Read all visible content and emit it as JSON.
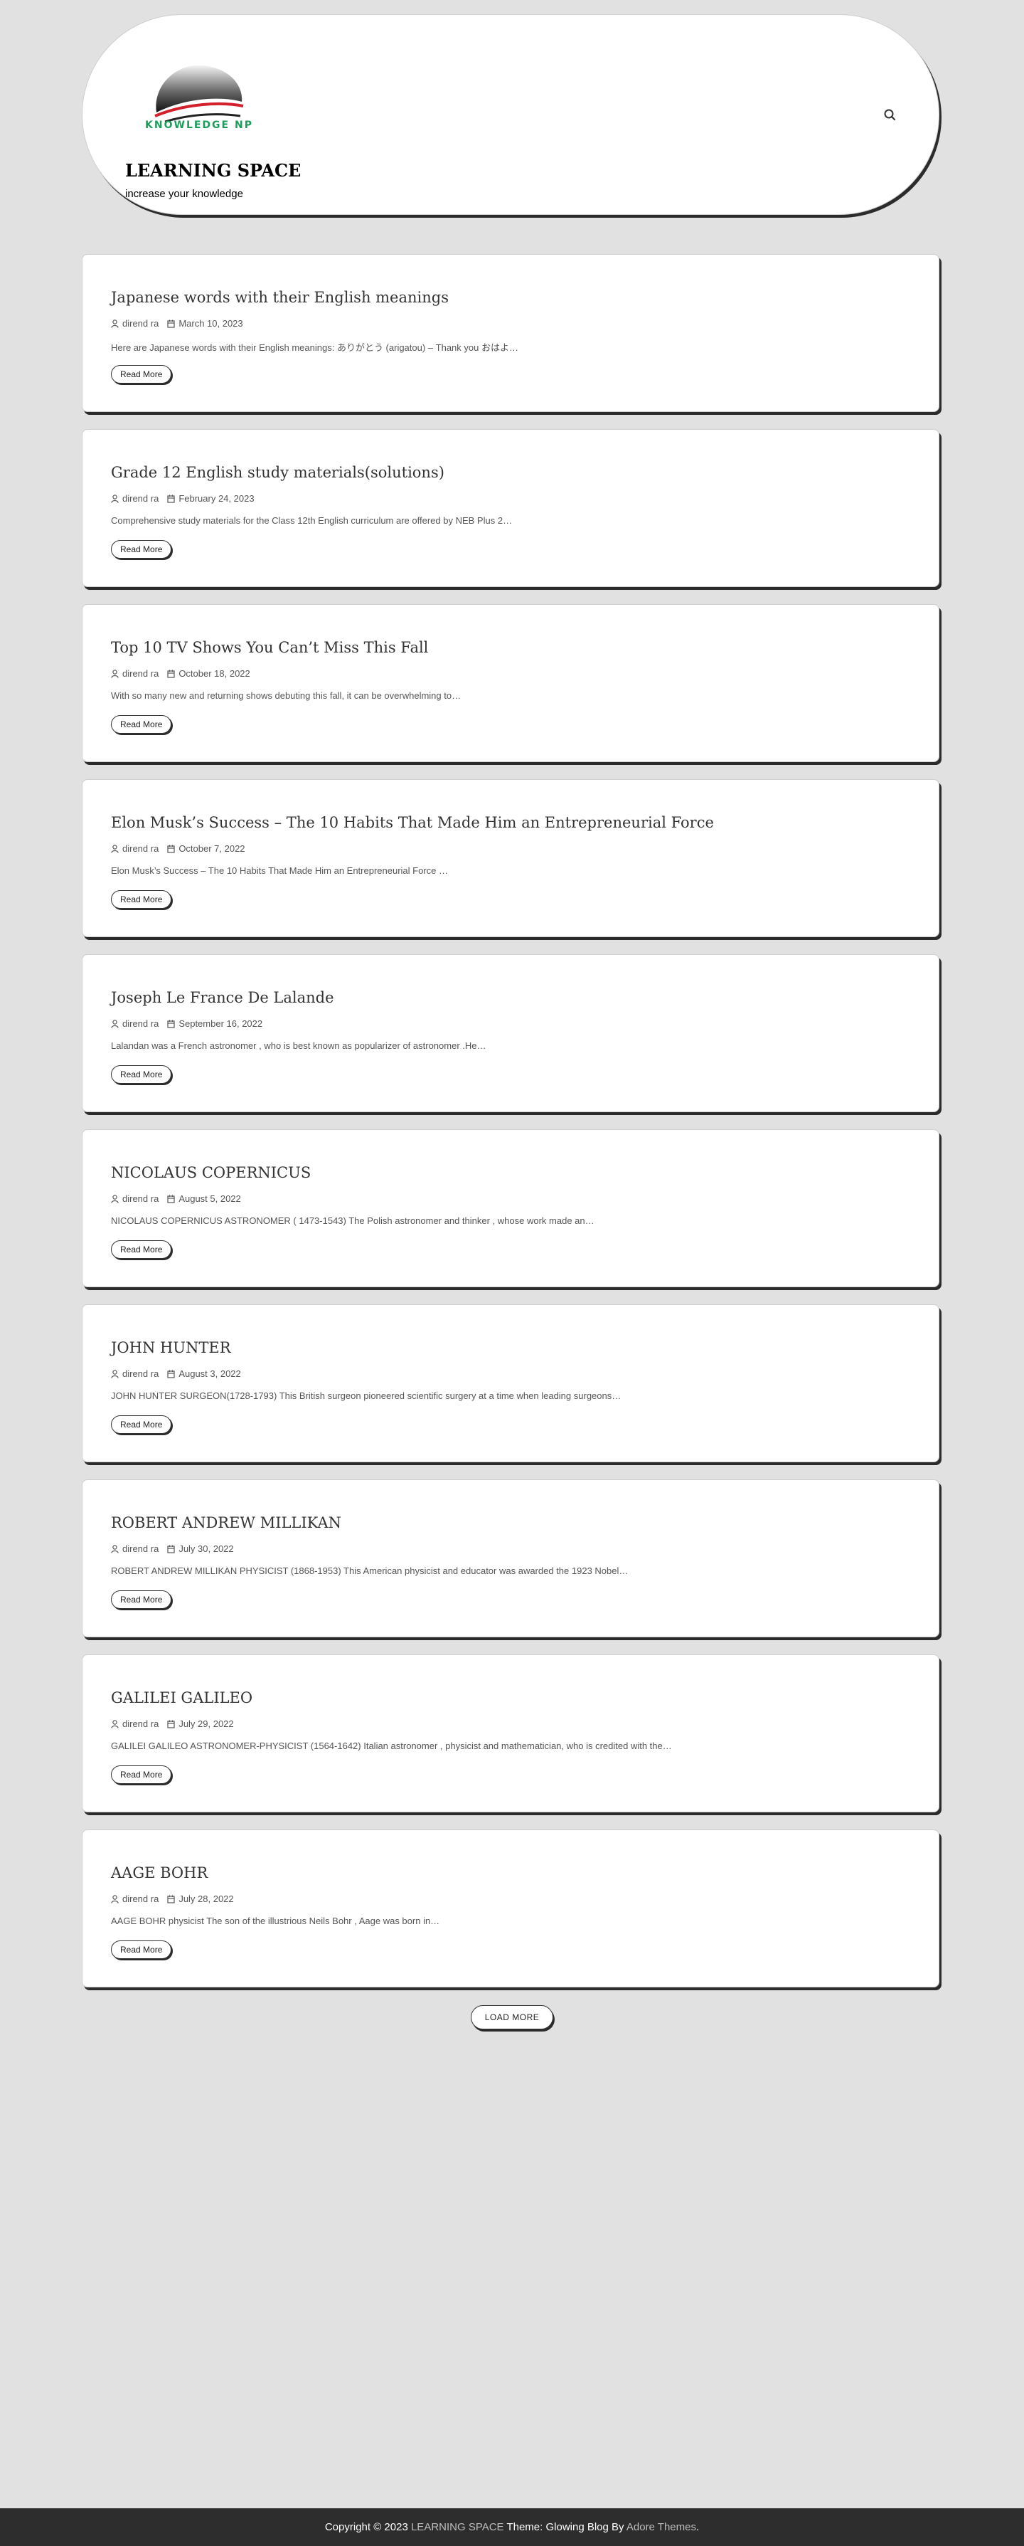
{
  "site": {
    "logo_text": "KNOWLEDGE NP",
    "title": "LEARNING SPACE",
    "description": "increase your knowledge",
    "search_icon": "search-icon"
  },
  "posts": [
    {
      "title": " Japanese words with their English meanings",
      "author": "dirend ra",
      "date": "March 10, 2023",
      "excerpt": "Here are  Japanese words with their English meanings:   ありがとう (arigatou) – Thank you おはよ…",
      "read_more": "Read More"
    },
    {
      "title": "Grade 12 English study materials(solutions)",
      "author": "dirend ra",
      "date": "February 24, 2023",
      "excerpt": "Comprehensive study materials for the Class 12th English curriculum are offered by NEB Plus 2…",
      "read_more": "Read More"
    },
    {
      "title": "Top 10 TV Shows You Can’t Miss This Fall",
      "author": "dirend ra",
      "date": "October 18, 2022",
      "excerpt": "With so many new and returning shows debuting this fall, it can be overwhelming to…",
      "read_more": "Read More"
    },
    {
      "title": "Elon Musk’s Success – The 10 Habits That Made Him an Entrepreneurial Force",
      "author": "dirend ra",
      "date": "October 7, 2022",
      "excerpt": " Elon Musk’s Success – The 10 Habits That Made Him an Entrepreneurial Force …",
      "read_more": "Read More"
    },
    {
      "title": "Joseph Le France De Lalande",
      "author": "dirend ra",
      "date": "September 16, 2022",
      "excerpt": "Lalandan was a French astronomer , who is best known as popularizer of astronomer .He…",
      "read_more": "Read More"
    },
    {
      "title": "NICOLAUS COPERNICUS",
      "author": "dirend ra",
      "date": "August 5, 2022",
      "excerpt": "NICOLAUS COPERNICUS ASTRONOMER ( 1473-1543) The Polish astronomer and thinker , whose work made an…",
      "read_more": "Read More"
    },
    {
      "title": "JOHN HUNTER",
      "author": "dirend ra",
      "date": "August 3, 2022",
      "excerpt": "JOHN HUNTER SURGEON(1728-1793) This British surgeon pioneered scientific surgery at a time when leading surgeons…",
      "read_more": "Read More"
    },
    {
      "title": "ROBERT ANDREW MILLIKAN",
      "author": "dirend ra",
      "date": "July 30, 2022",
      "excerpt": "ROBERT ANDREW MILLIKAN PHYSICIST (1868-1953) This American physicist and educator was awarded the 1923 Nobel…",
      "read_more": "Read More"
    },
    {
      "title": "GALILEI GALILEO",
      "author": "dirend ra",
      "date": "July 29, 2022",
      "excerpt": "GALILEI GALILEO ASTRONOMER-PHYSICIST (1564-1642) Italian astronomer , physicist and mathematician, who is credited with the…",
      "read_more": "Read More"
    },
    {
      "title": "AAGE BOHR",
      "author": "dirend ra",
      "date": "July 28, 2022",
      "excerpt": "AAGE BOHR physicist The son of the illustrious Neils Bohr , Aage was born in…",
      "read_more": "Read More"
    }
  ],
  "load_more": "LOAD MORE",
  "footer": {
    "copyright": "Copyright © 2023 ",
    "site_link": "LEARNING SPACE",
    "theme_text": " Theme: Glowing Blog By ",
    "theme_link": "Adore Themes",
    "end": "."
  }
}
